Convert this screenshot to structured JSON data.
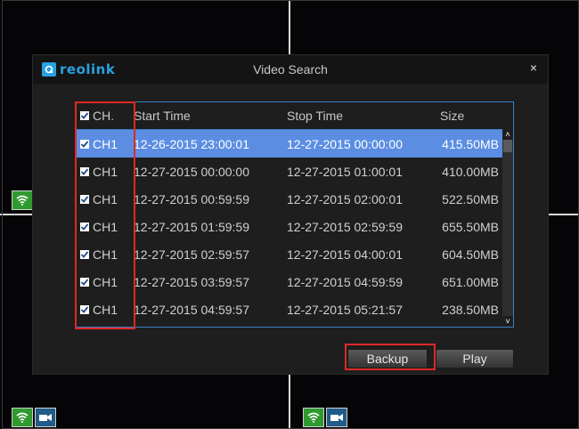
{
  "dialog": {
    "logo_text": "reolink",
    "title": "Video Search",
    "close_glyph": "×"
  },
  "table": {
    "headers": [
      "CH.",
      "Start Time",
      "Stop Time",
      "Size"
    ],
    "rows": [
      {
        "ch": "CH1",
        "start": "12-26-2015 23:00:01",
        "stop": "12-27-2015 00:00:00",
        "size": "415.50MB"
      },
      {
        "ch": "CH1",
        "start": "12-27-2015 00:00:00",
        "stop": "12-27-2015 01:00:01",
        "size": "410.00MB"
      },
      {
        "ch": "CH1",
        "start": "12-27-2015 00:59:59",
        "stop": "12-27-2015 02:00:01",
        "size": "522.50MB"
      },
      {
        "ch": "CH1",
        "start": "12-27-2015 01:59:59",
        "stop": "12-27-2015 02:59:59",
        "size": "655.50MB"
      },
      {
        "ch": "CH1",
        "start": "12-27-2015 02:59:57",
        "stop": "12-27-2015 04:00:01",
        "size": "604.50MB"
      },
      {
        "ch": "CH1",
        "start": "12-27-2015 03:59:57",
        "stop": "12-27-2015 04:59:59",
        "size": "651.00MB"
      },
      {
        "ch": "CH1",
        "start": "12-27-2015 04:59:57",
        "stop": "12-27-2015 05:21:57",
        "size": "238.50MB"
      }
    ]
  },
  "buttons": {
    "backup": "Backup",
    "play": "Play"
  },
  "colors": {
    "selected_row": "#5b8ee3",
    "table_border": "#3b82c4",
    "highlight_box": "#e02828",
    "logo": "#2aa0e0"
  }
}
